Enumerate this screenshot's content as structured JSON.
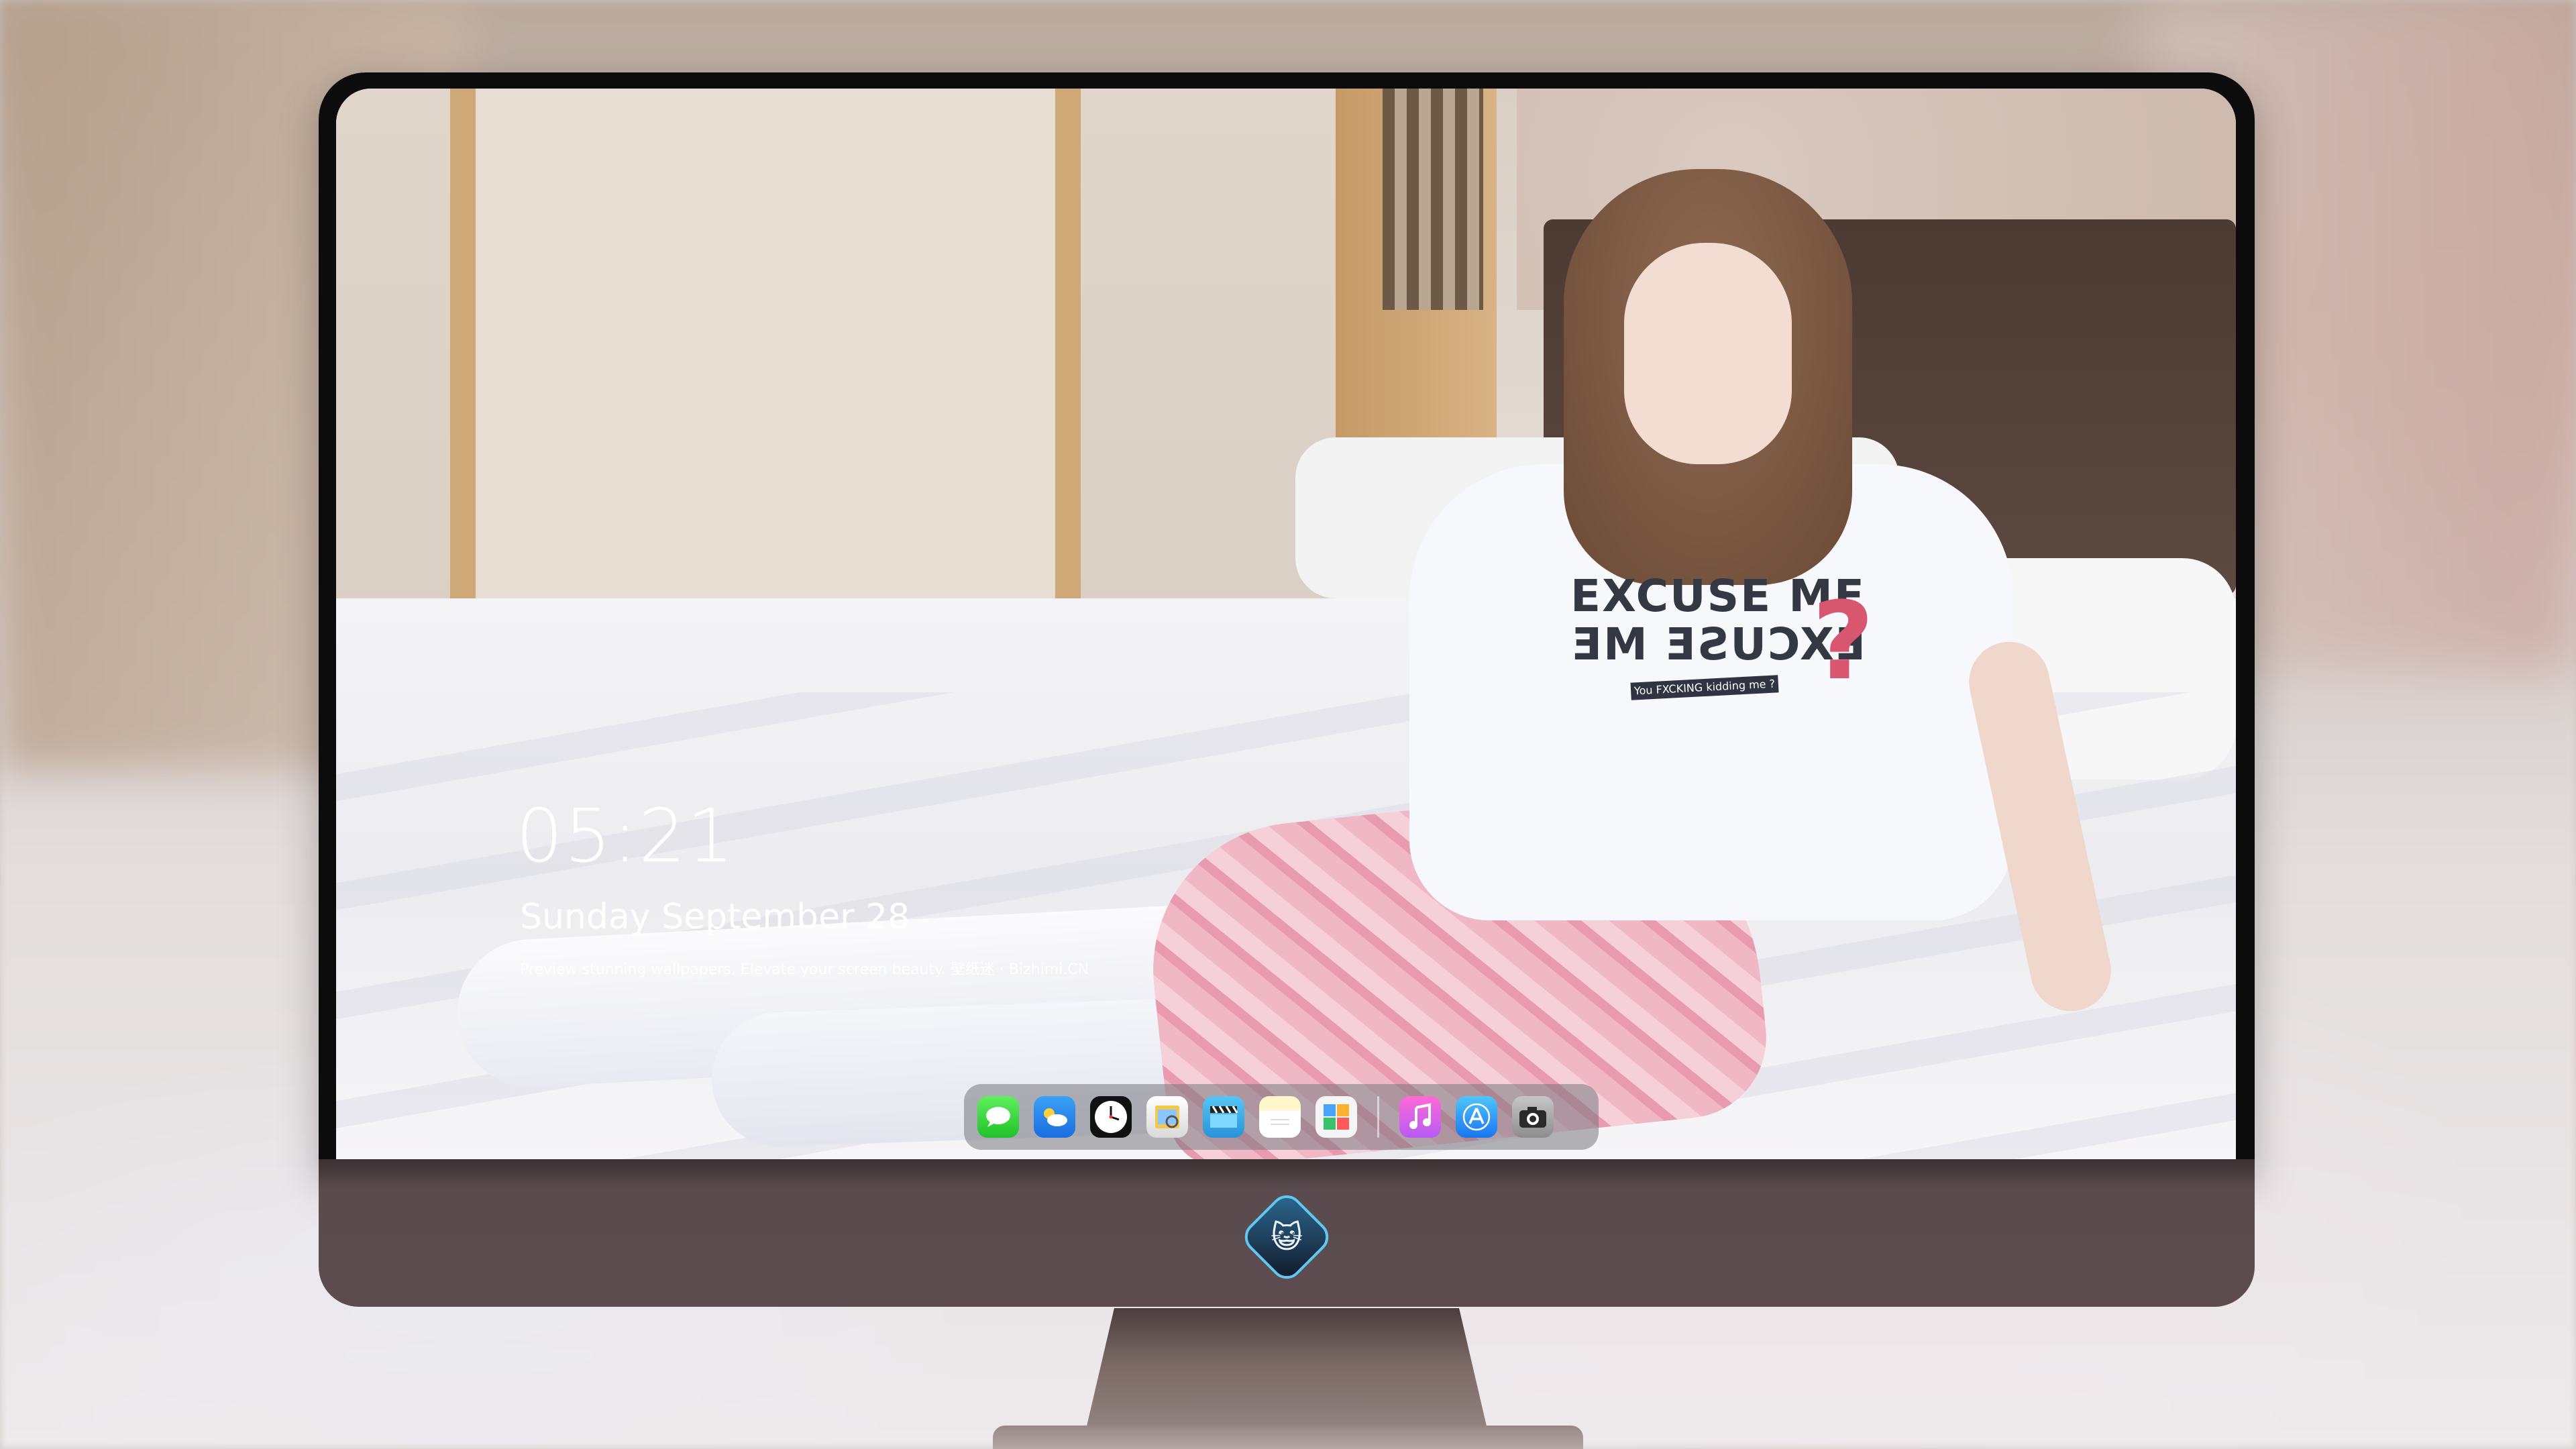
{
  "lock_screen": {
    "time": "05:21",
    "date": "Sunday September  28",
    "caption": "Preview stunning wallpapers, Elevate your screen beauty. 壁纸迷 · Bizhimi.CN"
  },
  "wallpaper": {
    "shirt_line1": "EXCUSE ME",
    "shirt_line2": "EXCUSE ME",
    "shirt_tagline": "You FXCKING kidding me ?"
  },
  "dock": {
    "apps": [
      {
        "name": "Messages",
        "icon": "messages-icon"
      },
      {
        "name": "Weather",
        "icon": "weather-icon"
      },
      {
        "name": "Clock",
        "icon": "clock-icon"
      },
      {
        "name": "Preview",
        "icon": "preview-icon"
      },
      {
        "name": "Video",
        "icon": "video-icon"
      },
      {
        "name": "Notes",
        "icon": "notes-icon"
      },
      {
        "name": "Photos",
        "icon": "photos-icon"
      },
      {
        "name": "Music",
        "icon": "music-icon"
      },
      {
        "name": "App Store",
        "icon": "app-store-icon"
      },
      {
        "name": "Camera",
        "icon": "camera-icon"
      }
    ]
  },
  "colors": {
    "bezel": "#0d0c0d",
    "chin": "#5c4c50",
    "dock_bg": "rgba(120,120,128,0.55)",
    "text": "#ffffff"
  }
}
